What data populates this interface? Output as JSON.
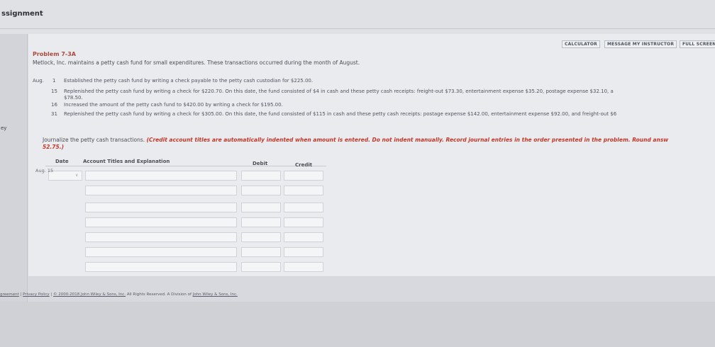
{
  "header": {
    "title": "ssignment"
  },
  "leftbar": {
    "label": "ey"
  },
  "toolbar": {
    "calculator": "CALCULATOR",
    "message": "MESSAGE MY INSTRUCTOR",
    "fullscreen": "FULL SCREEN"
  },
  "problem": {
    "title": "Problem 7-3A",
    "intro": "Metlock, Inc. maintains a petty cash fund for small expenditures. These transactions occurred during the month of August.",
    "month": "Aug.",
    "transactions": [
      {
        "day": "1",
        "text": "Established the petty cash fund by writing a check payable to the petty cash custodian for $225.00."
      },
      {
        "day": "15",
        "text": "Replenished the petty cash fund by writing a check for $220.70. On this date, the fund consisted of $4 in cash and these petty cash receipts: freight-out $73.30, entertainment expense $35.20, postage expense $32.10, a",
        "cont": "$78.50."
      },
      {
        "day": "16",
        "text": "Increased the amount of the petty cash fund to $420.00 by writing a check for $195.00."
      },
      {
        "day": "31",
        "text": "Replenished the petty cash fund by writing a check for $305.00. On this date, the fund consisted of $115 in cash and these petty cash receipts: postage expense $142.00, entertainment expense $92.00, and freight-out $6"
      }
    ]
  },
  "instructions": {
    "lead": "Journalize the petty cash transactions.",
    "red": "(Credit account titles are automatically indented when amount is entered. Do not indent manually. Record journal entries in the order presented in the problem. Round answ",
    "red2": "52.75.)"
  },
  "table": {
    "headers": {
      "date": "Date",
      "account": "Account Titles and Explanation",
      "debit": "Debit",
      "credit": "Credit"
    },
    "aug_label": "Aug. 15",
    "dropdown_glyph": "∨"
  },
  "footer": {
    "agreement": "greement",
    "sep": "|",
    "privacy": "Privacy Policy",
    "copyright": "© 2000-2018 John Wiley & Sons, Inc.",
    "rights": "All Rights Reserved. A Division of",
    "company": "John Wiley & Sons, Inc."
  }
}
